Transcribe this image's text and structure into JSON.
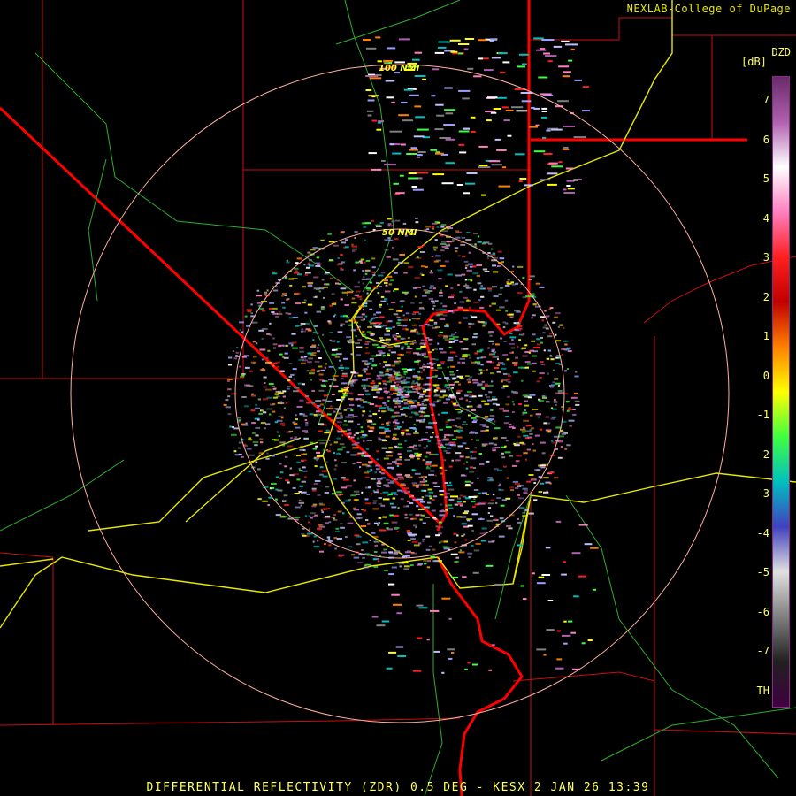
{
  "credit": "NEXLAB-College of DuPage",
  "product_code": "DZD",
  "units": "[dB]",
  "footer": "DIFFERENTIAL REFLECTIVITY (ZDR) 0.5 DEG - KESX 2 JAN 26 13:39",
  "range_rings": [
    "100 NMI",
    "50 NMI"
  ],
  "legend": {
    "ticks": [
      "7",
      "6",
      "5",
      "4",
      "3",
      "2",
      "1",
      "0",
      "-1",
      "-2",
      "-3",
      "-4",
      "-5",
      "-6",
      "-7",
      "TH"
    ],
    "colors_top_to_bottom": [
      "#6a2a6a",
      "#b060b0",
      "#ffffff",
      "#ff80c0",
      "#ff2020",
      "#c00000",
      "#ff8000",
      "#ffff00",
      "#40ff40",
      "#00c0c0",
      "#4040c0",
      "#e0e0e0",
      "#808080",
      "#202020",
      "#400040"
    ]
  },
  "colors": {
    "state_border": "#ff0000",
    "county_border": "#d01010",
    "highway": "#ffff00",
    "road": "#40c040",
    "range_ring": "#ffb0a0"
  }
}
